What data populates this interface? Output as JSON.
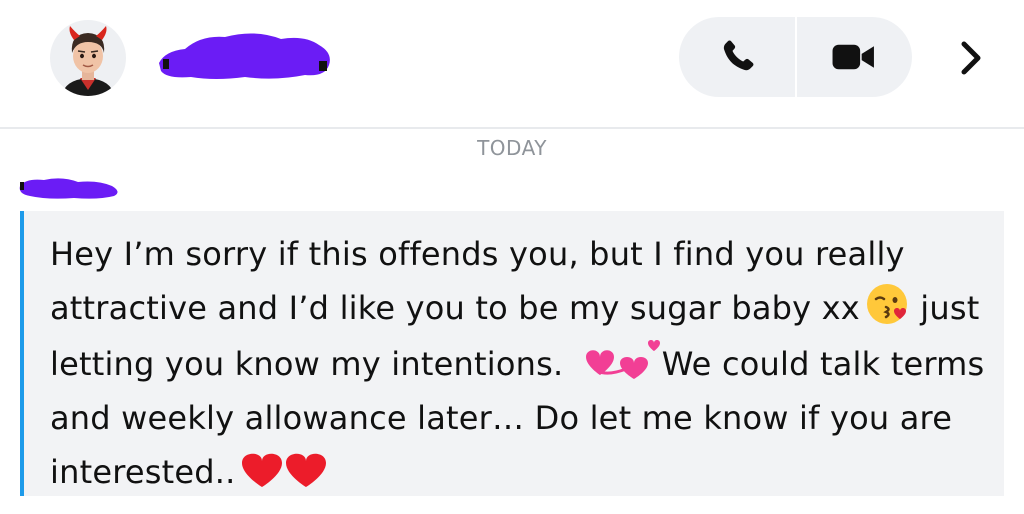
{
  "header": {
    "avatar_icon": "bitmoji-devil-avatar",
    "contact_name_redacted": true,
    "call_buttons": [
      {
        "icon": "phone-icon"
      },
      {
        "icon": "video-camera-icon"
      }
    ],
    "chevron_icon": "chevron-right-icon"
  },
  "chat": {
    "date_label": "TODAY",
    "sender_name_redacted": true,
    "message": {
      "accent_color": "#1e9bea",
      "segments": [
        {
          "text": "Hey I’m sorry if this offends you, but I find you really attractive and I’d like you to be my sugar baby xx"
        },
        {
          "emoji": "kissing-face-with-heart-emoji"
        },
        {
          "text": " just letting you know my intentions. "
        },
        {
          "emoji": "revolving-hearts-emoji"
        },
        {
          "text": "We could talk terms and weekly allowance later… Do let me know if you are interested.."
        },
        {
          "emoji": "red-heart-emoji"
        },
        {
          "emoji": "red-heart-emoji"
        }
      ]
    }
  },
  "colors": {
    "redaction": "#6b1cf5",
    "bubble_bg": "#f2f3f5",
    "pill_bg": "#eff1f4",
    "date_text": "#8f949a"
  }
}
